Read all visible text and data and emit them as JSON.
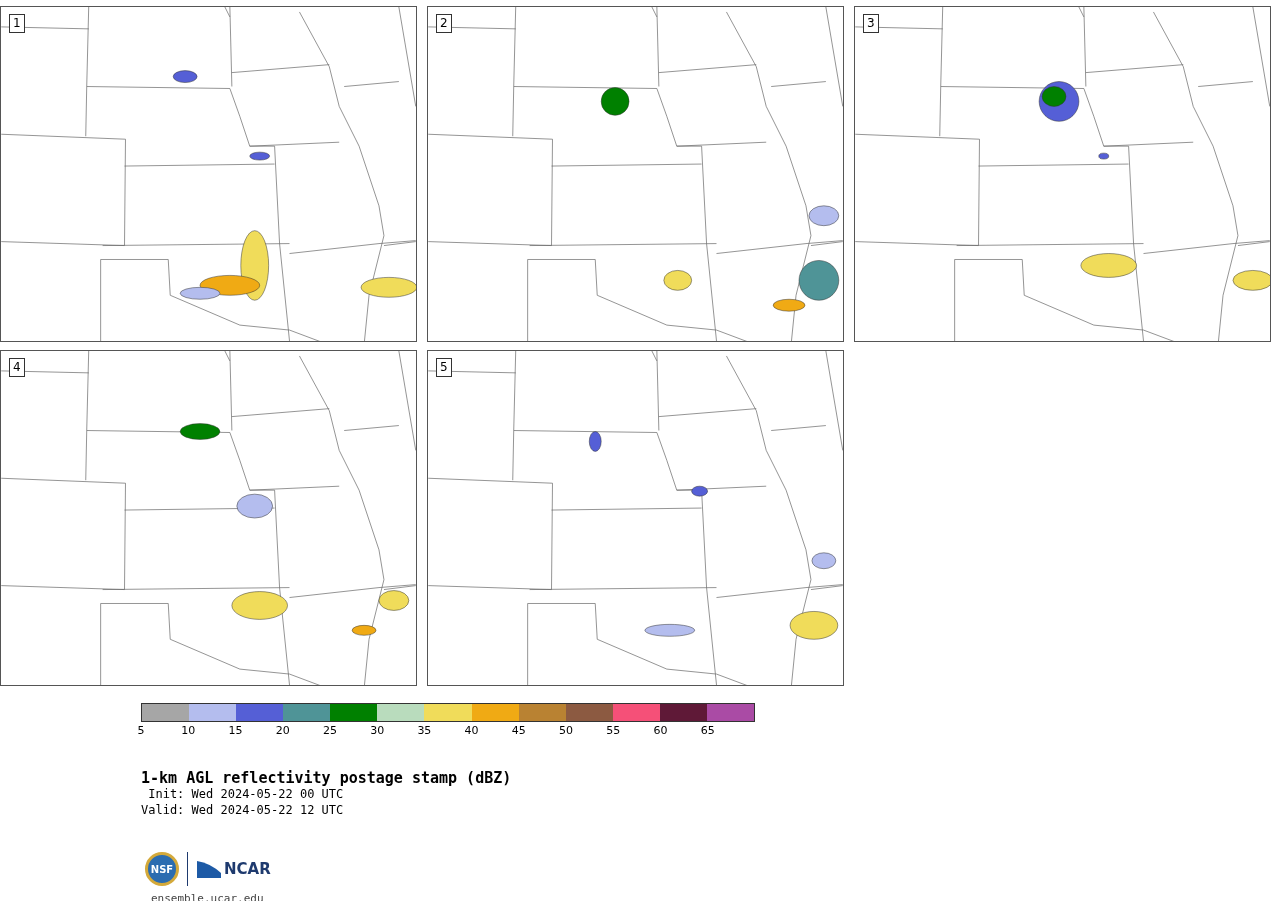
{
  "panels": [
    {
      "label": "1"
    },
    {
      "label": "2"
    },
    {
      "label": "3"
    },
    {
      "label": "4"
    },
    {
      "label": "5"
    }
  ],
  "colorbar": {
    "segments": [
      {
        "color": "#a6a6a6"
      },
      {
        "color": "#b4bdee"
      },
      {
        "color": "#555fd6"
      },
      {
        "color": "#4f9497"
      },
      {
        "color": "#008000"
      },
      {
        "color": "#b9dcbd"
      },
      {
        "color": "#f0dc5a"
      },
      {
        "color": "#f0aa14"
      },
      {
        "color": "#b98232"
      },
      {
        "color": "#8c5a41"
      },
      {
        "color": "#f55078"
      },
      {
        "color": "#5f1937"
      },
      {
        "color": "#aa4ba5"
      }
    ],
    "ticks": [
      "5",
      "10",
      "15",
      "20",
      "25",
      "30",
      "35",
      "40",
      "45",
      "50",
      "55",
      "60",
      "65"
    ]
  },
  "title": "1-km AGL reflectivity postage stamp (dBZ)",
  "init": " Init: Wed 2024-05-22 00 UTC",
  "valid": "Valid: Wed 2024-05-22 12 UTC",
  "logos": [
    {
      "text": "NSF"
    },
    {
      "text": "NCAR"
    }
  ],
  "url": "ensemble.ucar.edu"
}
